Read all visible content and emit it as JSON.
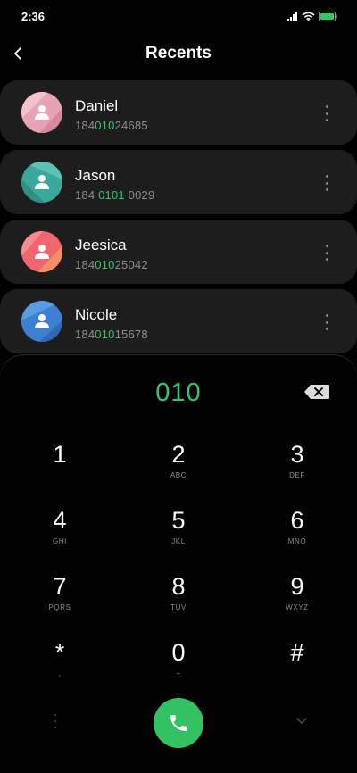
{
  "status_bar": {
    "time": "2:36",
    "icons": [
      "signal-icon",
      "wifi-icon",
      "battery-icon"
    ]
  },
  "header": {
    "title": "Recents",
    "back_icon": "chevron-left-icon"
  },
  "contacts": [
    {
      "name": "Daniel",
      "number_pre": "184",
      "number_hl": "010",
      "number_post": "24685",
      "avatar_color": "#e6a3b4"
    },
    {
      "name": "Jason",
      "number_pre": "184 ",
      "number_hl": "0101",
      "number_post": " 0029",
      "avatar_color": "#3aa89b"
    },
    {
      "name": "Jeesica",
      "number_pre": "184",
      "number_hl": "010",
      "number_post": "25042",
      "avatar_color": "#f06670"
    },
    {
      "name": "Nicole",
      "number_pre": "184",
      "number_hl": "010",
      "number_post": "15678",
      "avatar_color": "#3d7fd1"
    }
  ],
  "dialer": {
    "display": "010",
    "accent_color": "#35c46a",
    "keys": [
      {
        "digit": "1",
        "letters": ""
      },
      {
        "digit": "2",
        "letters": "ABC"
      },
      {
        "digit": "3",
        "letters": "DEF"
      },
      {
        "digit": "4",
        "letters": "GHI"
      },
      {
        "digit": "5",
        "letters": "JKL"
      },
      {
        "digit": "6",
        "letters": "MNO"
      },
      {
        "digit": "7",
        "letters": "PQRS"
      },
      {
        "digit": "8",
        "letters": "TUV"
      },
      {
        "digit": "9",
        "letters": "WXYZ"
      },
      {
        "digit": "*",
        "letters": ","
      },
      {
        "digit": "0",
        "letters": "+"
      },
      {
        "digit": "#",
        "letters": ""
      }
    ],
    "call_icon": "phone-icon",
    "call_color": "#33c263"
  }
}
